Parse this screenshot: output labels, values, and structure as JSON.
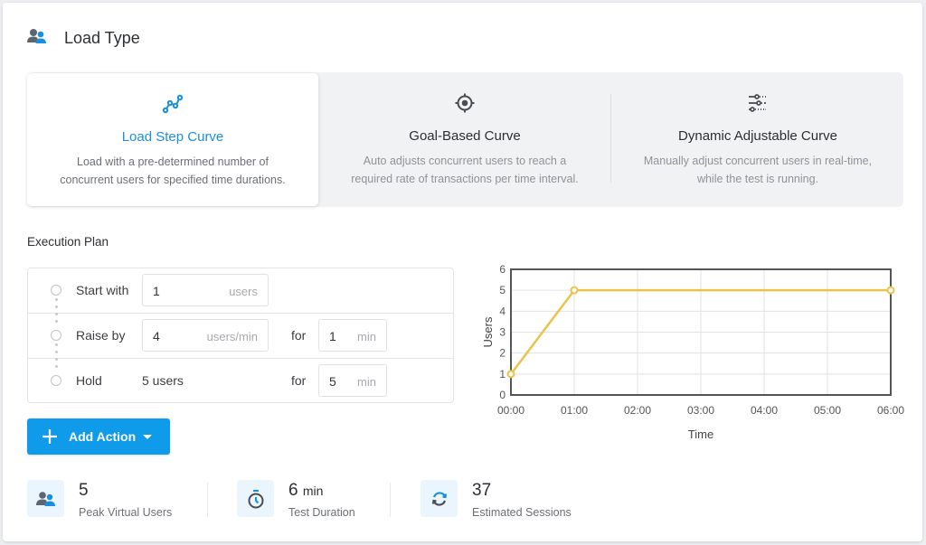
{
  "header": {
    "title": "Load Type",
    "icon": "users-icon"
  },
  "load_types": [
    {
      "name": "Load Step Curve",
      "description_line1": "Load with a pre-determined number of",
      "description_line2": "concurrent users for specified time durations.",
      "icon": "line-chart-icon",
      "selected": true
    },
    {
      "name": "Goal-Based Curve",
      "description_line1": "Auto adjusts concurrent users to reach a",
      "description_line2": "required rate of transactions per time interval.",
      "icon": "target-icon",
      "selected": false
    },
    {
      "name": "Dynamic Adjustable Curve",
      "description_line1": "Manually adjust concurrent users in real-time,",
      "description_line2": "while the test is running.",
      "icon": "sliders-icon",
      "selected": false
    }
  ],
  "execution_plan": {
    "title": "Execution Plan",
    "rows": [
      {
        "label": "Start with",
        "value": "1",
        "unit": "users"
      },
      {
        "label": "Raise by",
        "value": "4",
        "unit": "users/min",
        "for_label": "for",
        "duration": "1",
        "duration_unit": "min"
      },
      {
        "label": "Hold",
        "static": "5 users",
        "for_label": "for",
        "duration": "5",
        "duration_unit": "min"
      }
    ],
    "add_action_label": "Add Action"
  },
  "chart_data": {
    "type": "line",
    "title": "",
    "xlabel": "Time",
    "ylabel": "Users",
    "x_ticks": [
      "00:00",
      "01:00",
      "02:00",
      "03:00",
      "04:00",
      "05:00",
      "06:00"
    ],
    "y_ticks": [
      0,
      1,
      2,
      3,
      4,
      5,
      6
    ],
    "xlim": [
      0,
      6
    ],
    "ylim": [
      0,
      6
    ],
    "grid": true,
    "series": [
      {
        "name": "Users",
        "color": "#ebc24a",
        "x": [
          0,
          1,
          6
        ],
        "y": [
          1,
          5,
          5
        ]
      }
    ]
  },
  "stats": [
    {
      "value": "5",
      "unit": "",
      "label": "Peak Virtual Users",
      "icon": "users-icon"
    },
    {
      "value": "6",
      "unit": "min",
      "label": "Test Duration",
      "icon": "stopwatch-icon"
    },
    {
      "value": "37",
      "unit": "",
      "label": "Estimated Sessions",
      "icon": "refresh-icon"
    }
  ],
  "colors": {
    "accent": "#109bea",
    "active_text": "#1a8fdd",
    "chart_line": "#ebc24a"
  }
}
